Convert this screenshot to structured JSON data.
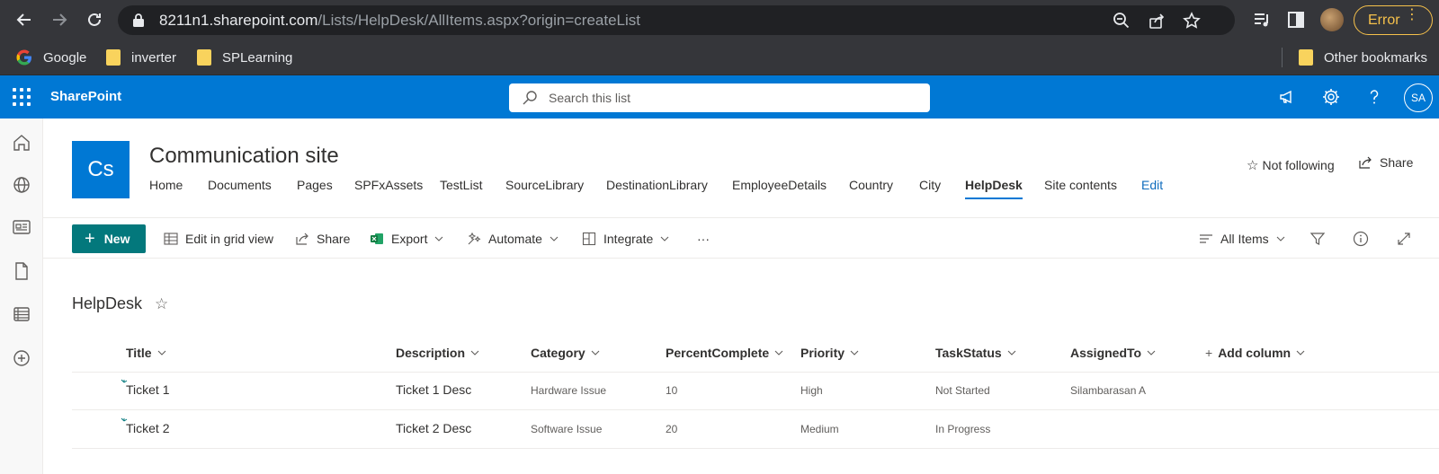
{
  "browser": {
    "url_host": "8211n1.sharepoint.com",
    "url_path": "/Lists/HelpDesk/AllItems.aspx?origin=createList",
    "error_label": "Error",
    "bookmarks": [
      "Google",
      "inverter",
      "SPLearning"
    ],
    "other_bookmarks": "Other bookmarks"
  },
  "suite": {
    "brand": "SharePoint",
    "search_placeholder": "Search this list",
    "user_initials": "SA"
  },
  "site": {
    "logo_initials": "Cs",
    "title": "Communication site",
    "nav": [
      "Home",
      "Documents",
      "Pages",
      "SPFxAssets",
      "TestList",
      "SourceLibrary",
      "DestinationLibrary",
      "EmployeeDetails",
      "Country",
      "City",
      "HelpDesk",
      "Site contents",
      "Edit"
    ],
    "active_nav": "HelpDesk",
    "follow_label": "Not following",
    "share_label": "Share"
  },
  "commands": {
    "new": "New",
    "edit_grid": "Edit in grid view",
    "share": "Share",
    "export": "Export",
    "automate": "Automate",
    "integrate": "Integrate",
    "more": "···",
    "view": "All Items"
  },
  "list": {
    "title": "HelpDesk",
    "columns": [
      "Title",
      "Description",
      "Category",
      "PercentComplete",
      "Priority",
      "TaskStatus",
      "AssignedTo",
      "Add column"
    ],
    "rows": [
      {
        "title": "Ticket 1",
        "description": "Ticket 1 Desc",
        "category": "Hardware Issue",
        "percent": "10",
        "priority": "High",
        "status": "Not Started",
        "assigned": "Silambarasan A"
      },
      {
        "title": "Ticket 2",
        "description": "Ticket 2 Desc",
        "category": "Software Issue",
        "percent": "20",
        "priority": "Medium",
        "status": "In Progress",
        "assigned": ""
      }
    ]
  },
  "colors": {
    "suite_blue": "#0078d4",
    "new_button": "#03787c",
    "browser_chrome": "#35363a"
  }
}
